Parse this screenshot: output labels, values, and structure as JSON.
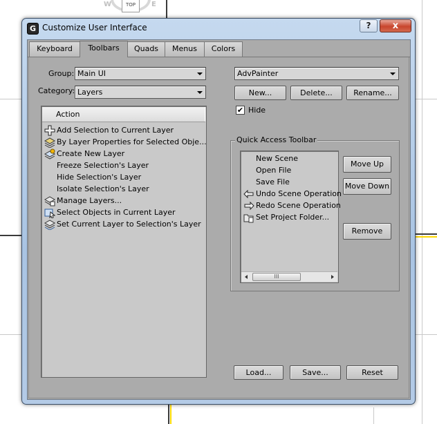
{
  "viewport": {
    "viewcube_face": "TOP",
    "compass_left": "W",
    "compass_right": "E"
  },
  "window": {
    "title": "Customize User Interface",
    "app_icon_letter": "G",
    "help_glyph": "?",
    "close_glyph": "x"
  },
  "tabs": [
    {
      "label": "Keyboard"
    },
    {
      "label": "Toolbars",
      "active": true
    },
    {
      "label": "Quads"
    },
    {
      "label": "Menus"
    },
    {
      "label": "Colors"
    }
  ],
  "left": {
    "group_label": "Group:",
    "group_value": "Main UI",
    "category_label": "Category:",
    "category_value": "Layers",
    "action_header": "Action",
    "actions": [
      {
        "label": "Add Selection to Current Layer",
        "icon": "plus-layer-icon"
      },
      {
        "label": "By Layer Properties for Selected Obje...",
        "icon": "layer-properties-icon"
      },
      {
        "label": "Create New Layer",
        "icon": "new-layer-icon"
      },
      {
        "label": "Freeze Selection's Layer",
        "icon": ""
      },
      {
        "label": "Hide Selection's Layer",
        "icon": ""
      },
      {
        "label": "Isolate Selection's Layer",
        "icon": ""
      },
      {
        "label": "Manage Layers...",
        "icon": "manage-layers-icon"
      },
      {
        "label": "Select Objects in Current Layer",
        "icon": "select-objects-icon"
      },
      {
        "label": "Set Current Layer to Selection's Layer",
        "icon": "set-current-layer-icon"
      }
    ]
  },
  "right": {
    "toolbar_value": "AdvPainter",
    "new_button": "New...",
    "delete_button": "Delete...",
    "rename_button": "Rename...",
    "hide_label": "Hide",
    "hide_checked": true,
    "hide_check_glyph": "✔",
    "quick_access_title": "Quick Access Toolbar",
    "quick_access_items": [
      {
        "label": "New Scene",
        "icon": ""
      },
      {
        "label": "Open File",
        "icon": ""
      },
      {
        "label": "Save File",
        "icon": ""
      },
      {
        "label": "Undo Scene Operation",
        "icon": "undo-icon"
      },
      {
        "label": "Redo Scene Operation",
        "icon": "redo-icon"
      },
      {
        "label": "Set Project Folder...",
        "icon": "project-folder-icon"
      }
    ],
    "move_up_button": "Move Up",
    "move_down_button": "Move Down",
    "remove_button": "Remove",
    "scroll_thumb_glyph": "III"
  },
  "footer": {
    "load_button": "Load...",
    "save_button": "Save...",
    "reset_button": "Reset"
  }
}
